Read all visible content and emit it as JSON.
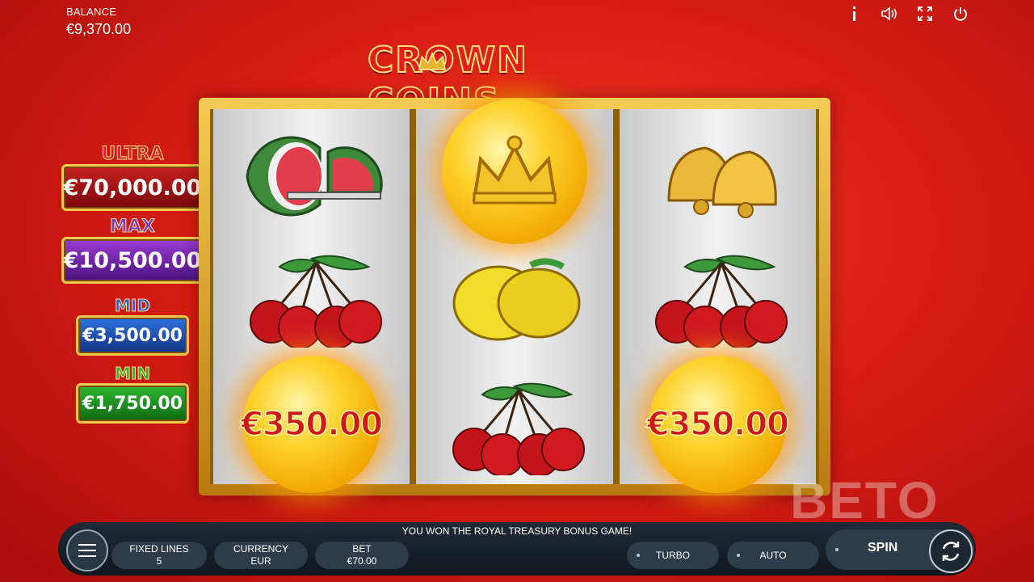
{
  "balance": {
    "label": "BALANCE",
    "value": "€9,370.00"
  },
  "top_icons": [
    "info-icon",
    "sound-icon",
    "fullscreen-icon",
    "power-icon"
  ],
  "logo": {
    "text": "CROWN COINS"
  },
  "jackpots": {
    "ultra": {
      "title": "ULTRA",
      "value": "€70,000.00"
    },
    "max": {
      "title": "MAX",
      "value": "€10,500.00"
    },
    "mid": {
      "title": "MID",
      "value": "€3,500.00"
    },
    "min": {
      "title": "MIN",
      "value": "€1,750.00"
    }
  },
  "reels": [
    [
      "watermelon-icon",
      "cherries-icon",
      "coin-value"
    ],
    [
      "crown-coin-icon",
      "lemons-icon",
      "cherries-icon"
    ],
    [
      "bells-icon",
      "cherries-icon",
      "coin-value"
    ]
  ],
  "coin_values": {
    "reel1": "€350.00",
    "reel3": "€350.00"
  },
  "message": "YOU WON THE ROYAL TREASURY BONUS GAME!",
  "controls": {
    "fixed_lines": {
      "label": "FIXED LINES",
      "value": "5"
    },
    "currency": {
      "label": "CURRENCY",
      "value": "EUR"
    },
    "bet": {
      "label": "BET",
      "value": "€70.00"
    },
    "turbo": "TURBO",
    "auto": "AUTO",
    "spin": "SPIN"
  },
  "watermark": "BETO",
  "colors": {
    "background": "#d81d12",
    "frame": "#f2c24a",
    "bar": "#17212a"
  }
}
